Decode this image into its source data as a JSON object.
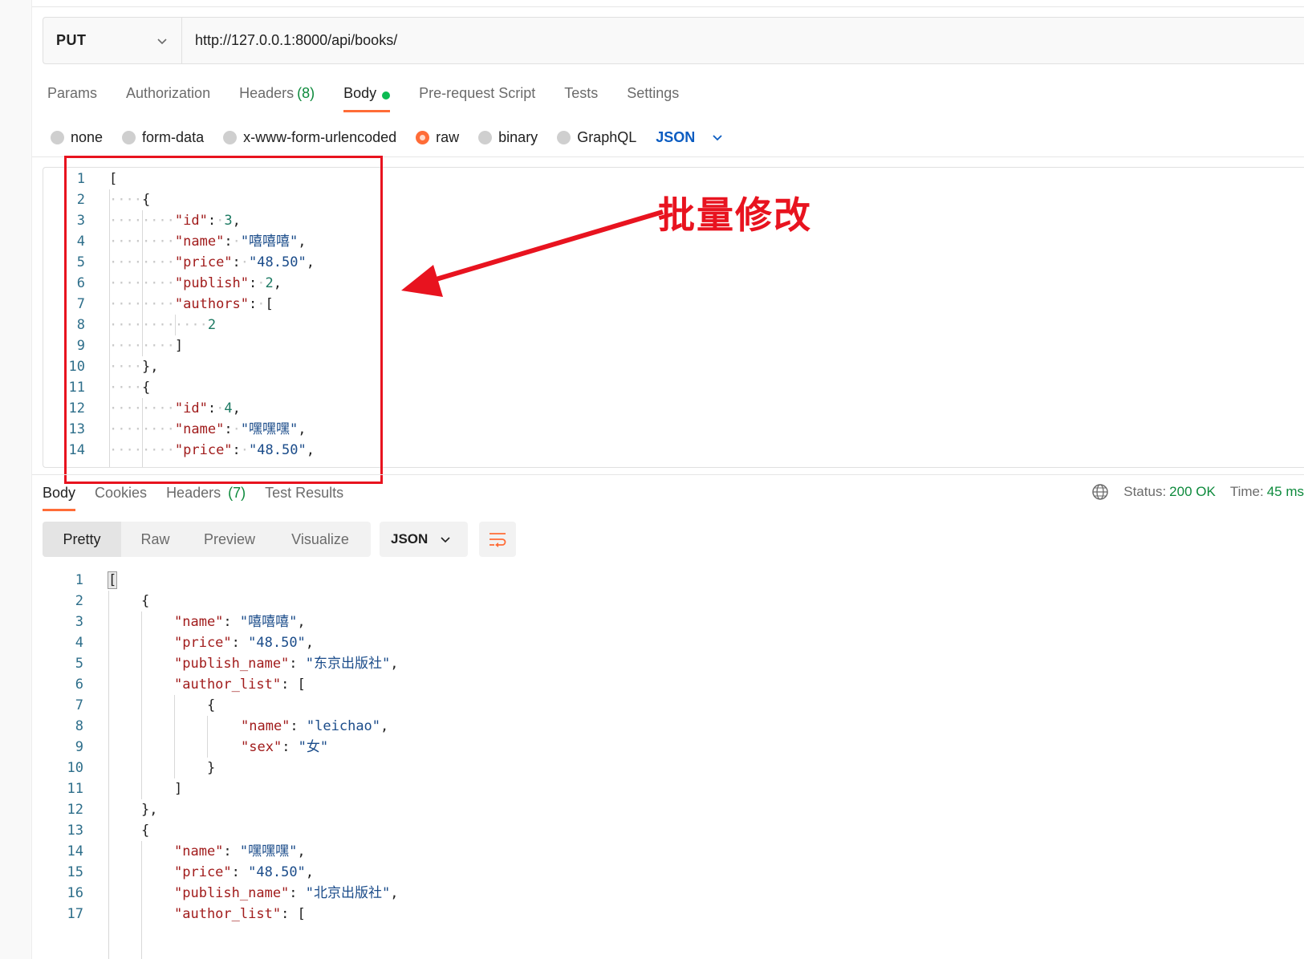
{
  "request": {
    "method": "PUT",
    "url": "http://127.0.0.1:8000/api/books/"
  },
  "request_tabs": [
    {
      "label": "Params"
    },
    {
      "label": "Authorization"
    },
    {
      "label": "Headers",
      "count": "(8)"
    },
    {
      "label": "Body"
    },
    {
      "label": "Pre-request Script"
    },
    {
      "label": "Tests"
    },
    {
      "label": "Settings"
    }
  ],
  "body_modes": [
    {
      "label": "none",
      "selected": false
    },
    {
      "label": "form-data",
      "selected": false
    },
    {
      "label": "x-www-form-urlencoded",
      "selected": false
    },
    {
      "label": "raw",
      "selected": true
    },
    {
      "label": "binary",
      "selected": false
    },
    {
      "label": "GraphQL",
      "selected": false
    }
  ],
  "body_format": "JSON",
  "request_body_lines": [
    "1",
    "2",
    "3",
    "4",
    "5",
    "6",
    "7",
    "8",
    "9",
    "10",
    "11",
    "12",
    "13",
    "14"
  ],
  "request_body": {
    "l1": "[",
    "l2": "{",
    "l3k": "\"id\"",
    "l3v": "3",
    "l4k": "\"name\"",
    "l4v": "\"嘻嘻嘻\"",
    "l5k": "\"price\"",
    "l5v": "\"48.50\"",
    "l6k": "\"publish\"",
    "l6v": "2",
    "l7k": "\"authors\"",
    "l7v": "[",
    "l8v": "2",
    "l9": "]",
    "l10": "},",
    "l11": "{",
    "l12k": "\"id\"",
    "l12v": "4",
    "l13k": "\"name\"",
    "l13v": "\"嘿嘿嘿\"",
    "l14k": "\"price\"",
    "l14v": "\"48.50\""
  },
  "annotation": "批量修改",
  "response_tabs": [
    {
      "label": "Body"
    },
    {
      "label": "Cookies"
    },
    {
      "label": "Headers",
      "count": "(7)"
    },
    {
      "label": "Test Results"
    }
  ],
  "response_status": {
    "status_label": "Status:",
    "status_value": "200 OK",
    "time_label": "Time:",
    "time_value": "45 ms"
  },
  "view_modes": [
    "Pretty",
    "Raw",
    "Preview",
    "Visualize"
  ],
  "response_format": "JSON",
  "response_body": {
    "l1": "[",
    "l2": "{",
    "l3k": "\"name\"",
    "l3v": "\"嘻嘻嘻\"",
    "l4k": "\"price\"",
    "l4v": "\"48.50\"",
    "l5k": "\"publish_name\"",
    "l5v": "\"东京出版社\"",
    "l6k": "\"author_list\"",
    "l6v": "[",
    "l7": "{",
    "l8k": "\"name\"",
    "l8v": "\"leichao\"",
    "l9k": "\"sex\"",
    "l9v": "\"女\"",
    "l10": "}",
    "l11": "]",
    "l12": "},",
    "l13": "{",
    "l14k": "\"name\"",
    "l14v": "\"嘿嘿嘿\"",
    "l15k": "\"price\"",
    "l15v": "\"48.50\"",
    "l16k": "\"publish_name\"",
    "l16v": "\"北京出版社\"",
    "l17k": "\"author_list\"",
    "l17v": "["
  },
  "response_body_lines": [
    "1",
    "2",
    "3",
    "4",
    "5",
    "6",
    "7",
    "8",
    "9",
    "10",
    "11",
    "12",
    "13",
    "14",
    "15",
    "16",
    "17"
  ]
}
